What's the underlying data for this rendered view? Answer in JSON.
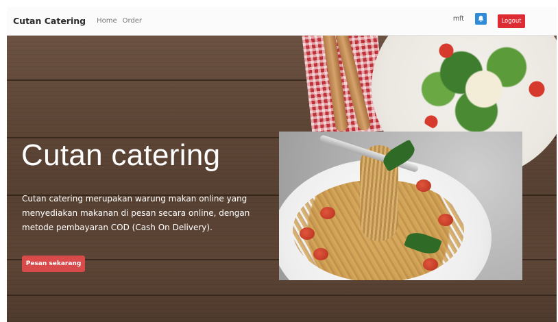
{
  "navbar": {
    "brand": "Cutan Catering",
    "links": [
      "Home",
      "Order"
    ],
    "user_name": "mft",
    "logout_label": "Logout"
  },
  "hero": {
    "title": "Cutan catering",
    "description": "Cutan catering merupakan warung makan online yang menyediakan makanan di pesan secara online, dengan metode pembayaran COD (Cash On Delivery).",
    "cta_label": "Pesan sekarang"
  },
  "icons": {
    "notification": "bell-icon"
  },
  "colors": {
    "logout": "#dd2b34",
    "cta": "#d94a4a",
    "notification": "#2f8bd8",
    "navbar_bg": "#fbfbfb"
  }
}
